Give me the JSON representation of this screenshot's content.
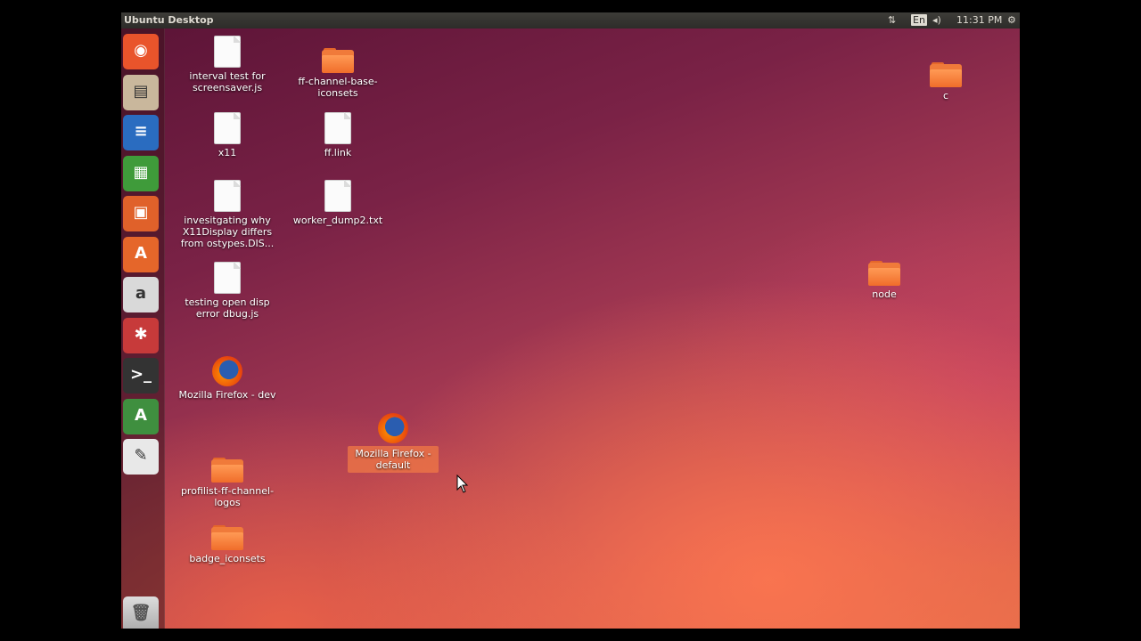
{
  "topbar": {
    "title": "Ubuntu Desktop",
    "keyboard": "En",
    "clock": "11:31 PM"
  },
  "launcher": [
    {
      "name": "launcher-dash-button",
      "icon": "ubuntu-logo-icon",
      "color": "#e9542b",
      "glyph": "◉"
    },
    {
      "name": "launcher-files-button",
      "icon": "files-icon",
      "color": "#c9b79c",
      "glyph": "▤"
    },
    {
      "name": "launcher-writer-button",
      "icon": "writer-icon",
      "color": "#2a6cc0",
      "glyph": "≡"
    },
    {
      "name": "launcher-calc-button",
      "icon": "calc-icon",
      "color": "#3f9b3a",
      "glyph": "▦"
    },
    {
      "name": "launcher-impress-button",
      "icon": "impress-icon",
      "color": "#e0612a",
      "glyph": "▣"
    },
    {
      "name": "launcher-software-center-button",
      "icon": "software-center-icon",
      "color": "#e5662a",
      "glyph": "A"
    },
    {
      "name": "launcher-amazon-button",
      "icon": "amazon-icon",
      "color": "#d9d9d9",
      "glyph": "a"
    },
    {
      "name": "launcher-settings-button",
      "icon": "system-settings-icon",
      "color": "#c73a3a",
      "glyph": "✱"
    },
    {
      "name": "launcher-terminal-button",
      "icon": "terminal-icon",
      "color": "#333333",
      "glyph": ">_"
    },
    {
      "name": "launcher-updater-button",
      "icon": "software-updater-icon",
      "color": "#3f8f3f",
      "glyph": "A"
    },
    {
      "name": "launcher-text-editor-button",
      "icon": "text-editor-icon",
      "color": "#e8e8e8",
      "glyph": "✎"
    }
  ],
  "trash_label": "trash-icon",
  "desktop_icons": [
    {
      "label": "interval test for screensaver.js",
      "kind": "file"
    },
    {
      "label": "ff-channel-base-iconsets",
      "kind": "folder"
    },
    {
      "label": "x11",
      "kind": "file"
    },
    {
      "label": "ff.link",
      "kind": "file"
    },
    {
      "label": "invesitgating why X11Display differs from ostypes.DIS...",
      "kind": "file"
    },
    {
      "label": "worker_dump2.txt",
      "kind": "file"
    },
    {
      "label": "testing open disp error dbug.js",
      "kind": "file"
    },
    {
      "label": "Mozilla Firefox - dev",
      "kind": "launcher"
    },
    {
      "label": "Mozilla Firefox - default",
      "kind": "launcher",
      "selected": true
    },
    {
      "label": "profilist-ff-channel-logos",
      "kind": "folder"
    },
    {
      "label": "badge_iconsets",
      "kind": "folder"
    },
    {
      "label": "c",
      "kind": "folder"
    },
    {
      "label": "node",
      "kind": "folder"
    }
  ]
}
